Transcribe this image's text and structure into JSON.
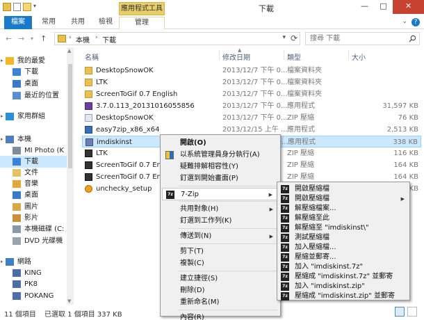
{
  "window": {
    "title": "下載",
    "context_tab_title": "應用程式工具",
    "buttons": {
      "minimize": "—",
      "maximize": "□",
      "close": "✕"
    }
  },
  "ribbon": {
    "tabs": [
      "檔案",
      "常用",
      "共用",
      "檢視",
      "管理"
    ],
    "help": "?",
    "collapse": "⌄"
  },
  "address": {
    "back": "←",
    "forward": "→",
    "up": "↑",
    "crumbs": [
      "本機",
      "下載"
    ],
    "search_placeholder": "搜尋 下載"
  },
  "nav": {
    "items": [
      {
        "label": "我的最愛",
        "level": 0,
        "icon": "star-icon"
      },
      {
        "label": "下載",
        "level": 1,
        "icon": "download-folder-icon"
      },
      {
        "label": "桌面",
        "level": 1,
        "icon": "desktop-icon"
      },
      {
        "label": "最近的位置",
        "level": 1,
        "icon": "recent-places-icon"
      },
      {
        "label": "家用群組",
        "level": 0,
        "icon": "homegroup-icon"
      },
      {
        "label": "本機",
        "level": 0,
        "icon": "computer-icon"
      },
      {
        "label": "MI Photo (K",
        "level": 1,
        "icon": "drive-icon"
      },
      {
        "label": "下載",
        "level": 1,
        "icon": "download-folder-icon",
        "selected": true
      },
      {
        "label": "文件",
        "level": 1,
        "icon": "documents-icon"
      },
      {
        "label": "音樂",
        "level": 1,
        "icon": "music-icon"
      },
      {
        "label": "桌面",
        "level": 1,
        "icon": "desktop-icon"
      },
      {
        "label": "圖片",
        "level": 1,
        "icon": "pictures-icon"
      },
      {
        "label": "影片",
        "level": 1,
        "icon": "videos-icon"
      },
      {
        "label": "本機磁碟 (C:",
        "level": 1,
        "icon": "disk-icon"
      },
      {
        "label": "DVD 光碟機",
        "level": 1,
        "icon": "dvd-icon"
      },
      {
        "label": "網路",
        "level": 0,
        "icon": "network-icon"
      },
      {
        "label": "KING",
        "level": 1,
        "icon": "pc-icon"
      },
      {
        "label": "PK8",
        "level": 1,
        "icon": "pc-icon"
      },
      {
        "label": "POKANG",
        "level": 1,
        "icon": "pc-icon"
      }
    ]
  },
  "columns": {
    "name": "名稱",
    "date": "修改日期",
    "type": "類型",
    "size": "大小"
  },
  "files": [
    {
      "name": "DesktopSnowOK",
      "date": "2013/12/7 下午 0...",
      "type": "檔案資料夾",
      "size": "",
      "icon": "folder-icon"
    },
    {
      "name": "LTK",
      "date": "2013/12/7 下午 0...",
      "type": "檔案資料夾",
      "size": "",
      "icon": "folder-icon"
    },
    {
      "name": "ScreenToGif 0.7 English",
      "date": "2013/12/7 下午 0...",
      "type": "檔案資料夾",
      "size": "",
      "icon": "folder-icon"
    },
    {
      "name": "3.7.0.113_20131016055856",
      "date": "2013/12/7 下午 0...",
      "type": "應用程式",
      "size": "31,597 KB",
      "icon": "vs-app-icon"
    },
    {
      "name": "DesktopSnowOK",
      "date": "2013/12/7 下午 0...",
      "type": "ZIP 壓縮",
      "size": "76 KB",
      "icon": "snow-icon"
    },
    {
      "name": "easy7zip_x86_x64",
      "date": "2013/12/15 上午 ...",
      "type": "應用程式",
      "size": "2,513 KB",
      "icon": "installer-icon"
    },
    {
      "name": "imdiskinst",
      "date": "2013/12/7 下午 0...",
      "type": "應用程式",
      "size": "338 KB",
      "icon": "app-icon",
      "selected": true
    },
    {
      "name": "LTK",
      "date": "",
      "type": "ZIP 壓縮",
      "size": "116 KB",
      "icon": "zip-icon"
    },
    {
      "name": "ScreenToGif 0.7 Engli",
      "date": "",
      "type": "ZIP 壓縮",
      "size": "164 KB",
      "icon": "zip-icon"
    },
    {
      "name": "ScreenToGif 0.7 Engli",
      "date": "",
      "type": "ZIP 壓縮",
      "size": "164 KB",
      "icon": "zip-icon"
    },
    {
      "name": "unchecky_setup",
      "date": "",
      "type": "應用程式",
      "size": "1,663 KB",
      "icon": "unchecky-icon"
    }
  ],
  "context_menu": [
    {
      "label": "開啟(O)",
      "bold": true
    },
    {
      "label": "以系統管理員身分執行(A)",
      "icon": "shield-icon"
    },
    {
      "label": "疑難排解相容性(Y)"
    },
    {
      "label": "釘選到開始畫面(P)"
    },
    {
      "sep": true
    },
    {
      "label": "7-Zip",
      "icon": "7zip-icon",
      "submenu": true,
      "highlight": true
    },
    {
      "sep": true
    },
    {
      "label": "共用對象(H)",
      "submenu": true
    },
    {
      "label": "釘選到工作列(K)"
    },
    {
      "sep": true
    },
    {
      "label": "傳送到(N)",
      "submenu": true
    },
    {
      "sep": true
    },
    {
      "label": "剪下(T)"
    },
    {
      "label": "複製(C)"
    },
    {
      "sep": true
    },
    {
      "label": "建立捷徑(S)"
    },
    {
      "label": "刪除(D)"
    },
    {
      "label": "重新命名(M)"
    },
    {
      "sep": true
    },
    {
      "label": "內容(R)"
    }
  ],
  "submenu_7zip": [
    {
      "label": "開啟壓縮檔"
    },
    {
      "label": "開啟壓縮檔",
      "submenu": true
    },
    {
      "label": "解壓縮檔案..."
    },
    {
      "label": "解壓縮至此"
    },
    {
      "label": "解壓縮至 \"imdiskinst\\\""
    },
    {
      "label": "測試壓縮檔"
    },
    {
      "label": "加入壓縮檔..."
    },
    {
      "label": "壓縮並郵寄..."
    },
    {
      "label": "加入 \"imdiskinst.7z\""
    },
    {
      "label": "壓縮成 \"imdiskinst.7z\" 並郵寄"
    },
    {
      "label": "加入 \"imdiskinst.zip\""
    },
    {
      "label": "壓縮成 \"imdiskinst.zip\" 並郵寄"
    }
  ],
  "status": {
    "count": "11 個項目",
    "selected": "已選取 1 個項目  337 KB"
  }
}
